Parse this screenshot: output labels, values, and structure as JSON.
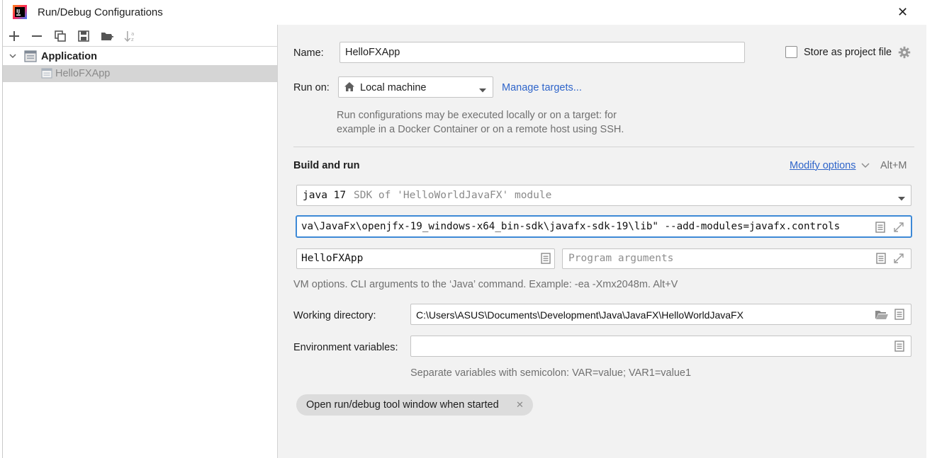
{
  "window": {
    "title": "Run/Debug Configurations",
    "close_glyph": "✕"
  },
  "tree": {
    "group_label": "Application",
    "item_label": "HelloFXApp"
  },
  "form": {
    "name_label": "Name:",
    "name_value": "HelloFXApp",
    "store_label": "Store as project file",
    "run_on_label": "Run on:",
    "run_on_value": "Local machine",
    "manage_targets": "Manage targets...",
    "run_hint_line1": "Run configurations may be executed locally or on a target: for",
    "run_hint_line2": "example in a Docker Container or on a remote host using SSH.",
    "build_run_title": "Build and run",
    "modify_options": "Modify options",
    "modify_shortcut": "Alt+M",
    "sdk_bold": "java 17",
    "sdk_desc": "SDK of 'HelloWorldJavaFX' module",
    "vm_options_value": "va\\JavaFx\\openjfx-19_windows-x64_bin-sdk\\javafx-sdk-19\\lib\" --add-modules=javafx.controls",
    "main_class_value": "HelloFXApp",
    "program_args_placeholder": "Program arguments",
    "vm_hint": "VM options. CLI arguments to the ‘Java’ command. Example: -ea -Xmx2048m. Alt+V",
    "working_dir_label": "Working directory:",
    "working_dir_value": "C:\\Users\\ASUS\\Documents\\Development\\Java\\JavaFX\\HelloWorldJavaFX",
    "env_label": "Environment variables:",
    "env_value": "",
    "env_hint": "Separate variables with semicolon: VAR=value; VAR1=value1",
    "chip_label": "Open run/debug tool window when started",
    "chip_close": "✕"
  }
}
